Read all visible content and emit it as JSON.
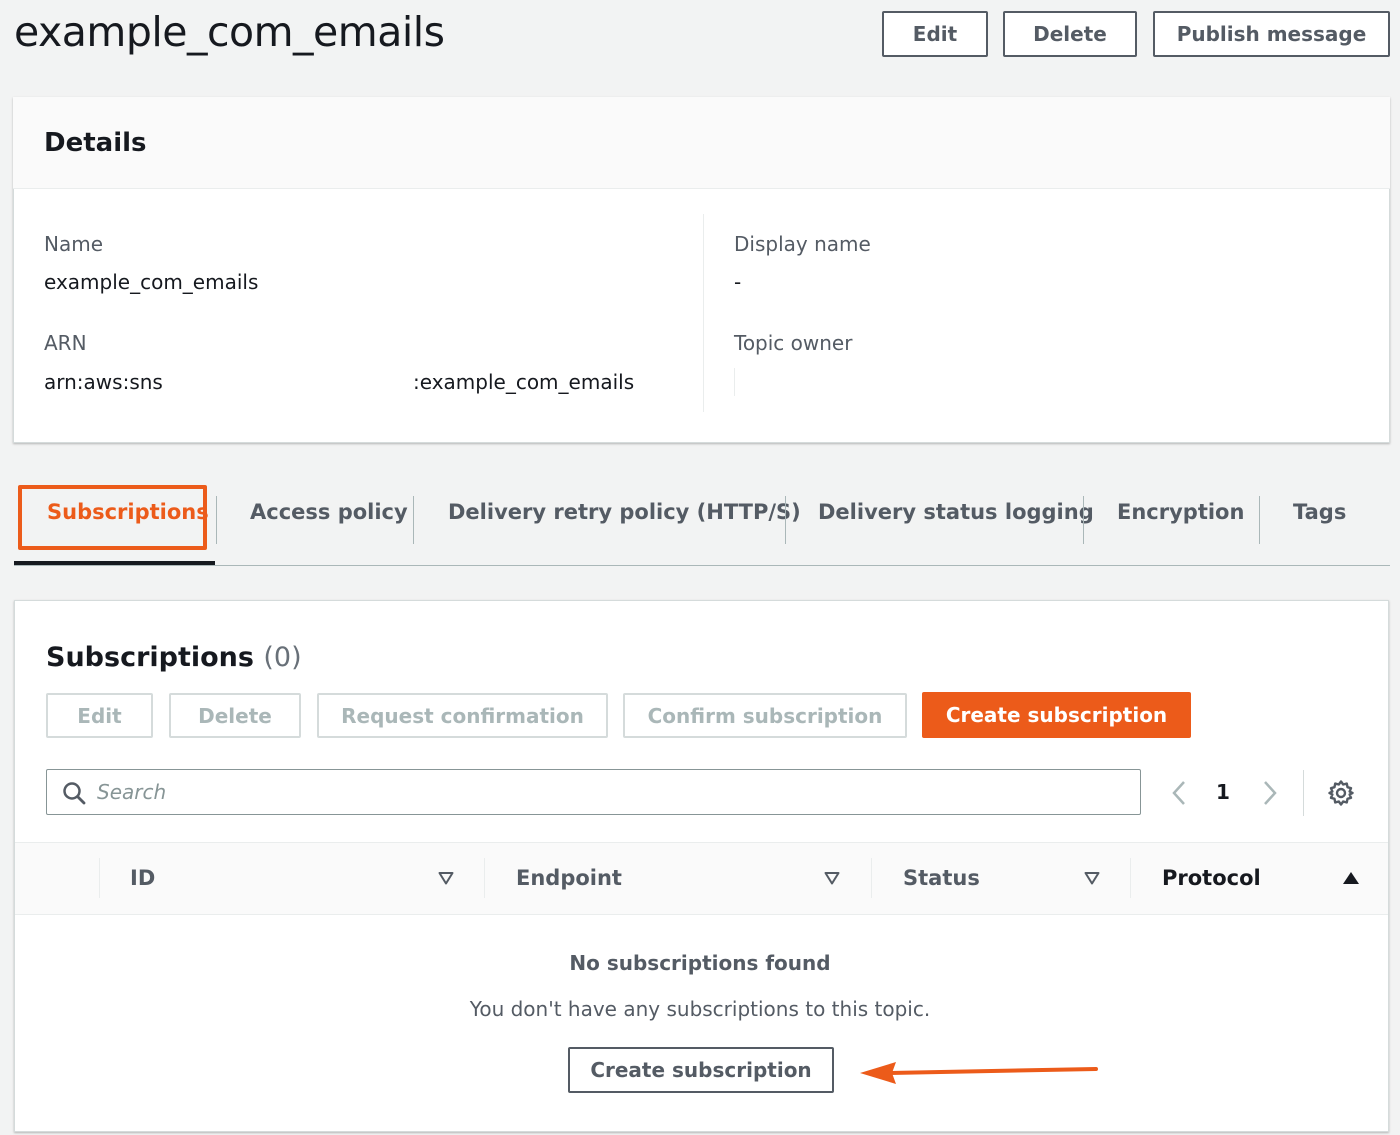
{
  "header": {
    "title": "example_com_emails",
    "edit_label": "Edit",
    "delete_label": "Delete",
    "publish_label": "Publish message"
  },
  "details": {
    "title": "Details",
    "name_label": "Name",
    "name_value": "example_com_emails",
    "arn_label": "ARN",
    "arn_prefix": "arn:aws:sns:",
    "arn_suffix": ":example_com_emails",
    "display_name_label": "Display name",
    "display_name_value": "-",
    "topic_owner_label": "Topic owner"
  },
  "tabs": [
    {
      "label": "Subscriptions",
      "active": true
    },
    {
      "label": "Access policy"
    },
    {
      "label": "Delivery retry policy (HTTP/S)"
    },
    {
      "label": "Delivery status logging"
    },
    {
      "label": "Encryption"
    },
    {
      "label": "Tags"
    }
  ],
  "subscriptions": {
    "title": "Subscriptions",
    "count": "(0)",
    "edit_label": "Edit",
    "delete_label": "Delete",
    "request_confirmation_label": "Request confirmation",
    "confirm_subscription_label": "Confirm subscription",
    "create_label": "Create subscription",
    "search_placeholder": "Search",
    "page": "1",
    "columns": [
      "ID",
      "Endpoint",
      "Status",
      "Protocol"
    ],
    "empty_title": "No subscriptions found",
    "empty_desc": "You don't have any subscriptions to this topic.",
    "empty_create_label": "Create subscription"
  },
  "colors": {
    "accent": "#ec5b1a",
    "text": "#16191f",
    "muted": "#545b64",
    "background": "#f2f3f3"
  }
}
